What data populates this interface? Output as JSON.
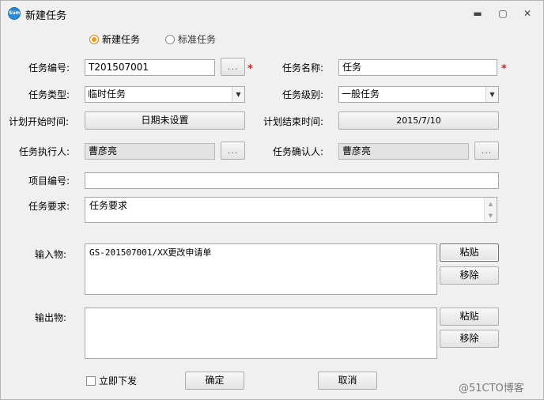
{
  "window": {
    "title": "新建任务",
    "app_icon_text": "Sum",
    "min_glyph": "▬",
    "max_glyph": "▢",
    "close_glyph": "✕"
  },
  "mode": {
    "options": [
      "新建任务",
      "标准任务"
    ],
    "selected": "新建任务"
  },
  "form": {
    "task_no_label": "任务编号:",
    "task_no_value": "T201507001",
    "task_no_browse": "...",
    "task_name_label": "任务名称:",
    "task_name_value": "任务",
    "required_mark": "*",
    "task_type_label": "任务类型:",
    "task_type_value": "临时任务",
    "task_level_label": "任务级别:",
    "task_level_value": "一般任务",
    "plan_start_label": "计划开始时间:",
    "plan_start_value": "日期未设置",
    "plan_end_label": "计划结束时间:",
    "plan_end_value": "2015/7/10",
    "executor_label": "任务执行人:",
    "executor_value": "曹彦亮",
    "executor_browse": "...",
    "confirmer_label": "任务确认人:",
    "confirmer_value": "曹彦亮",
    "confirmer_browse": "...",
    "project_no_label": "项目编号:",
    "project_no_value": "",
    "requirement_label": "任务要求:",
    "requirement_value": "任务要求"
  },
  "inputs": {
    "label": "输入物:",
    "content": "GS-201507001/XX更改申请单",
    "paste_label": "粘贴",
    "remove_label": "移除"
  },
  "outputs": {
    "label": "输出物:",
    "content": "",
    "paste_label": "粘贴",
    "remove_label": "移除"
  },
  "footer": {
    "issue_now_label": "立即下发",
    "issue_now_checked": false,
    "ok_label": "确定",
    "cancel_label": "取消"
  },
  "watermark": "@51CTO博客",
  "colors": {
    "radio_selected": "#f39b12",
    "required": "#d81e1e",
    "readonly_bg": "#e3e3e3"
  }
}
